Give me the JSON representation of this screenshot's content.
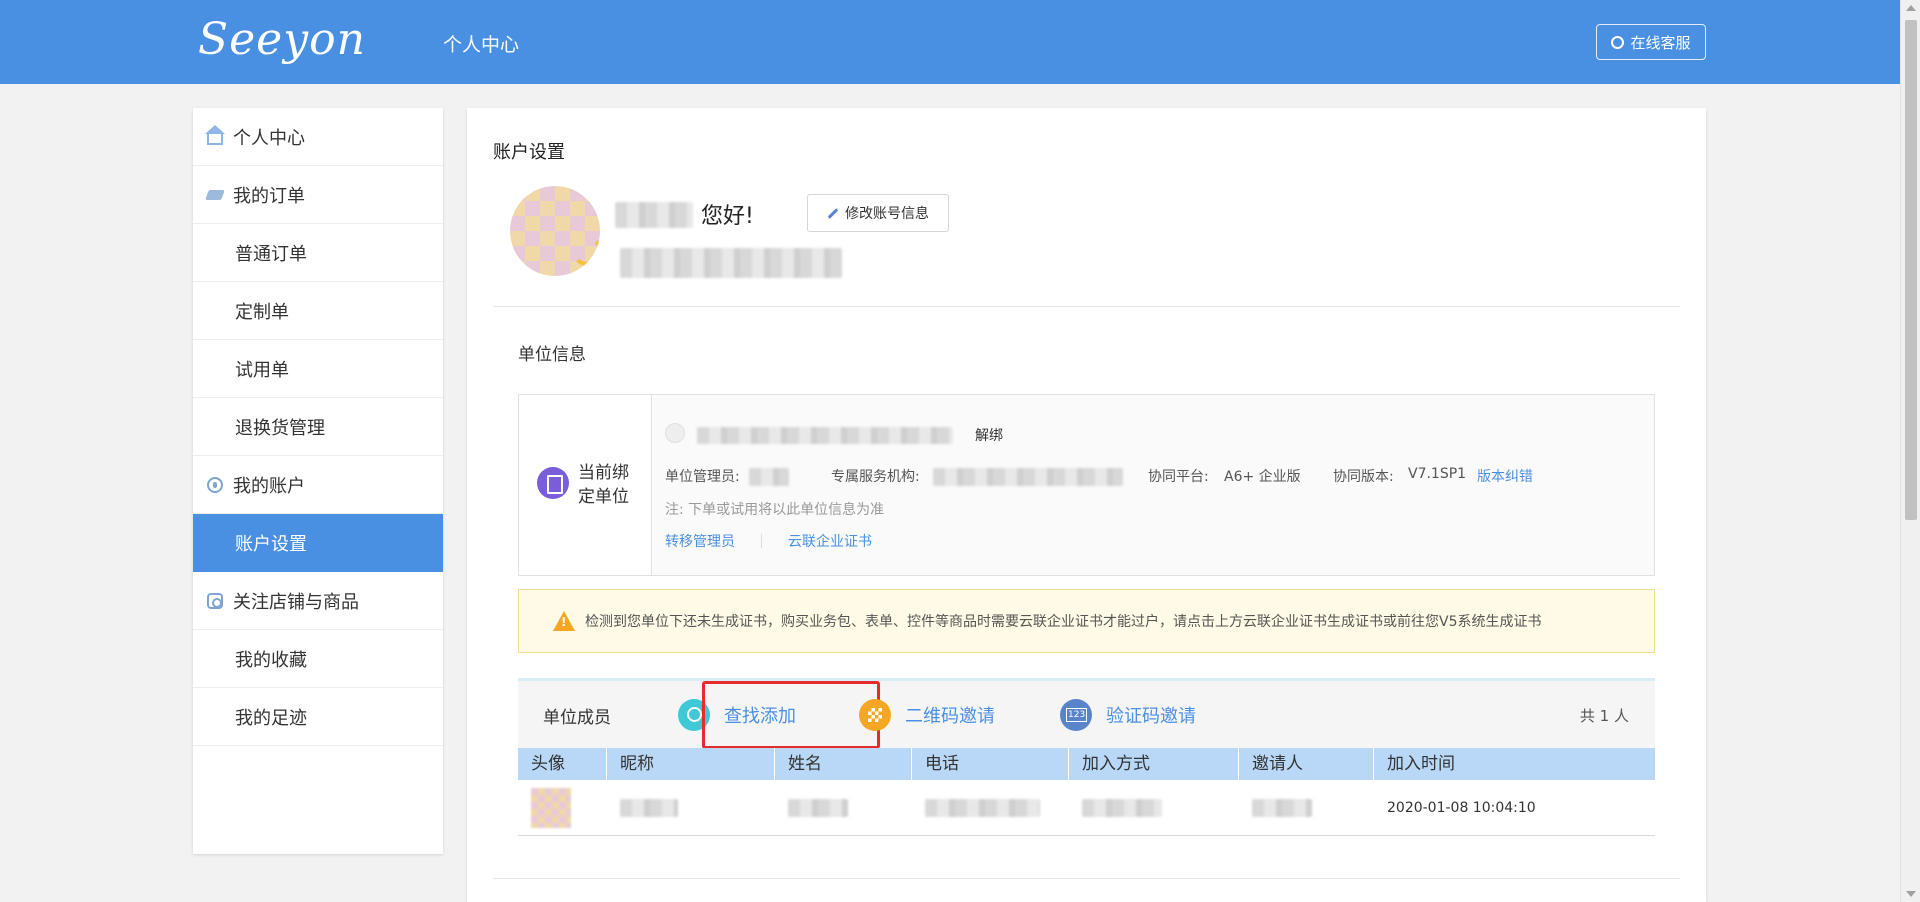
{
  "header": {
    "logo": "Seeyon",
    "title": "个人中心",
    "service_label": "在线客服"
  },
  "sidebar": {
    "items": [
      {
        "label": "个人中心"
      },
      {
        "label": "我的订单"
      },
      {
        "label": "普通订单"
      },
      {
        "label": "定制单"
      },
      {
        "label": "试用单"
      },
      {
        "label": "退换货管理"
      },
      {
        "label": "我的账户"
      },
      {
        "label": "账户设置"
      },
      {
        "label": "关注店铺与商品"
      },
      {
        "label": "我的收藏"
      },
      {
        "label": "我的足迹"
      }
    ]
  },
  "main": {
    "page_title": "账户设置",
    "greeting": "您好!",
    "edit_label": "修改账号信息",
    "unit_section_title": "单位信息",
    "current_unit_label": "当前绑定单位",
    "unbind_label": "解绑",
    "admin_label": "单位管理员:",
    "service_org_label": "专属服务机构:",
    "platform_label": "协同平台:",
    "platform_value": "A6+ 企业版",
    "version_label": "协同版本:",
    "version_value": "V7.1SP1",
    "version_fix_label": "版本纠错",
    "note": "注: 下单或试用将以此单位信息为准",
    "transfer_admin_label": "转移管理员",
    "cert_label": "云联企业证书",
    "warning": "检测到您单位下还未生成证书，购买业务包、表单、控件等商品时需要云联企业证书才能过户，请点击上方云联企业证书生成证书或前往您V5系统生成证书",
    "members_title": "单位成员",
    "find_add_label": "查找添加",
    "qr_invite_label": "二维码邀请",
    "code_invite_label": "验证码邀请",
    "member_count": "共 1 人",
    "table_headers": [
      "头像",
      "昵称",
      "姓名",
      "电话",
      "加入方式",
      "邀请人",
      "加入时间"
    ],
    "rows": [
      {
        "join_time": "2020-01-08 10:04:10"
      }
    ]
  },
  "colors": {
    "brand": "#4a90e2",
    "highlight": "#e52b2b",
    "warning_bg": "#fffbe6"
  }
}
